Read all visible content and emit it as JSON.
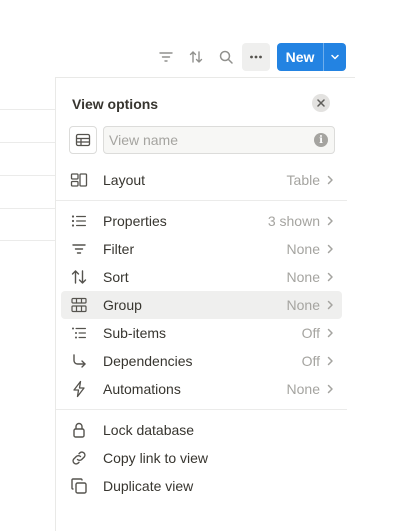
{
  "toolbar": {
    "icons": [
      "filter-icon",
      "sort-icon",
      "search-icon",
      "more-icon"
    ],
    "new_label": "New"
  },
  "panel": {
    "title": "View options",
    "view_name_placeholder": "View name",
    "rows": {
      "layout": {
        "label": "Layout",
        "value": "Table"
      },
      "properties": {
        "label": "Properties",
        "value": "3 shown"
      },
      "filter": {
        "label": "Filter",
        "value": "None"
      },
      "sort": {
        "label": "Sort",
        "value": "None"
      },
      "group": {
        "label": "Group",
        "value": "None"
      },
      "subitems": {
        "label": "Sub-items",
        "value": "Off"
      },
      "dependencies": {
        "label": "Dependencies",
        "value": "Off"
      },
      "automations": {
        "label": "Automations",
        "value": "None"
      },
      "lock": {
        "label": "Lock database"
      },
      "copy_link": {
        "label": "Copy link to view"
      },
      "duplicate": {
        "label": "Duplicate view"
      }
    }
  },
  "colors": {
    "accent": "#2383e2",
    "hover_row": "#efefee",
    "muted_text": "#a5a4a0"
  }
}
